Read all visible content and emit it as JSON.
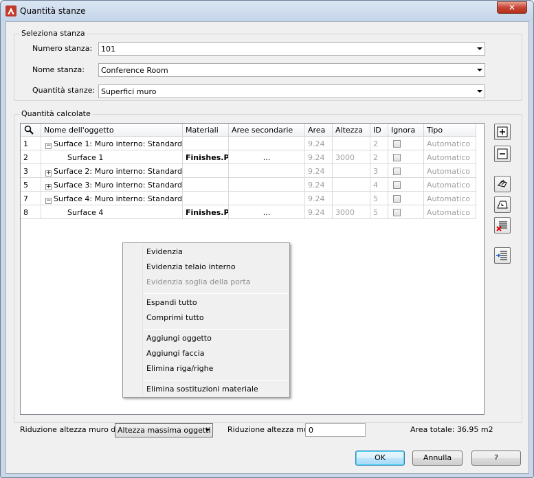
{
  "window": {
    "title": "Quantità stanze",
    "close_label": "✕"
  },
  "select_room": {
    "group_title": "Seleziona stanza",
    "room_number_label": "Numero stanza:",
    "room_number_value": "101",
    "room_name_label": "Nome stanza:",
    "room_name_value": "Conference Room",
    "room_qty_label": "Quantità stanze:",
    "room_qty_value": "Superfici muro"
  },
  "calc": {
    "group_title": "Quantità calcolate",
    "columns": [
      "Nome dell'oggetto",
      "Materiali",
      "Aree secondarie",
      "Area",
      "Altezza",
      "ID",
      "Ignora",
      "Tipo"
    ],
    "rows": [
      {
        "num": "1",
        "tree": "minus",
        "name": "Surface 1: Muro interno: Standard",
        "material": "",
        "sub": "",
        "area": "9.24",
        "height": "",
        "id": "2",
        "type": "Automatico"
      },
      {
        "num": "2",
        "tree": "child",
        "name": "Surface 1",
        "material": "Finishes.Pla",
        "sub": "...",
        "area": "9.24",
        "height": "3000",
        "id": "2",
        "type": "Automatico"
      },
      {
        "num": "3",
        "tree": "plus",
        "name": "Surface 2: Muro interno: Standard",
        "material": "",
        "sub": "",
        "area": "9.24",
        "height": "",
        "id": "3",
        "type": "Automatico"
      },
      {
        "num": "5",
        "tree": "plus",
        "name": "Surface 3: Muro interno: Standard",
        "material": "",
        "sub": "",
        "area": "9.24",
        "height": "",
        "id": "4",
        "type": "Automatico"
      },
      {
        "num": "7",
        "tree": "minus",
        "name": "Surface 4: Muro interno: Standard",
        "material": "",
        "sub": "",
        "area": "9.24",
        "height": "",
        "id": "5",
        "type": "Automatico"
      },
      {
        "num": "8",
        "tree": "child",
        "name": "Surface 4",
        "material": "Finishes.Pla",
        "sub": "...",
        "area": "9.24",
        "height": "3000",
        "id": "5",
        "type": "Automatico"
      }
    ]
  },
  "context_menu": {
    "items": [
      "Evidenzia",
      "Evidenzia telaio interno",
      "Evidenzia soglia della porta",
      "Espandi tutto",
      "Comprimi tutto",
      "Aggiungi oggetto",
      "Aggiungi faccia",
      "Elimina riga/righe",
      "Elimina sostituzioni materiale"
    ]
  },
  "footer": {
    "reduction_label": "Riduzione altezza muro da",
    "reduction_value": "Altezza massima oggetti",
    "reduction2_label": "Riduzione altezza muro",
    "reduction2_value": "0",
    "total_area": "Area totale: 36.95 m2",
    "ok": "OK",
    "cancel": "Annulla",
    "help": "?"
  },
  "colors": {
    "accent": "#c0392b",
    "title_bg": "#c9d7e8"
  }
}
